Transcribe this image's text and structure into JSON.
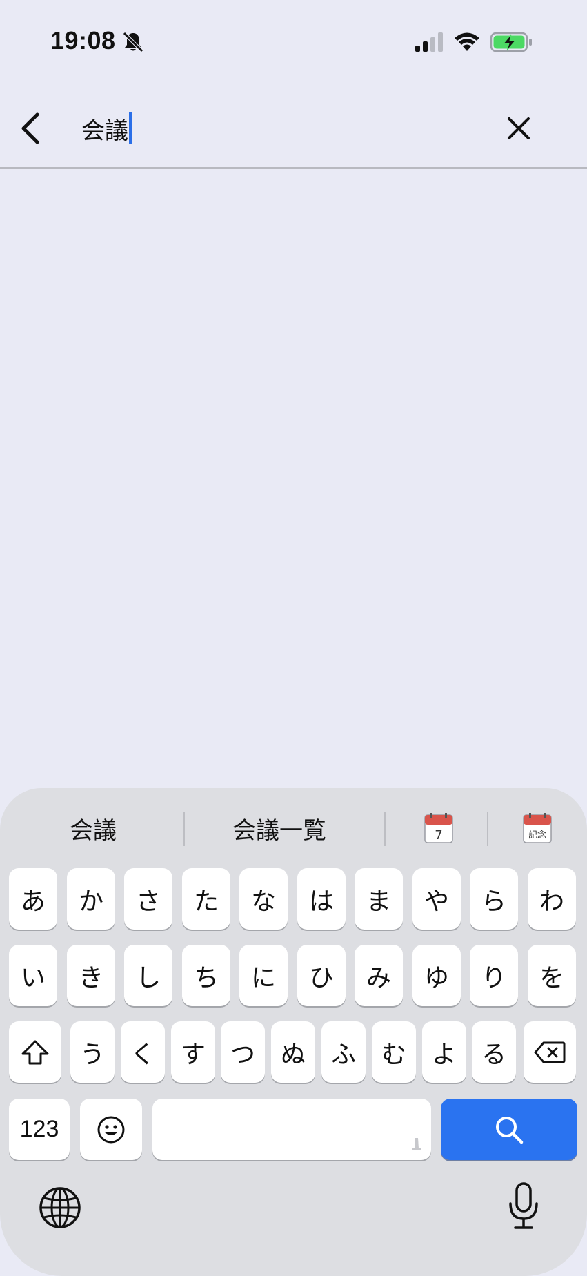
{
  "status_bar": {
    "time": "19:08",
    "icons": [
      "bell-off-icon",
      "cellular-signal-icon",
      "wifi-icon",
      "battery-charging-icon"
    ],
    "battery_color": "#4CD964"
  },
  "search": {
    "query": "会議",
    "caret_color": "#2B6FE8"
  },
  "keyboard": {
    "suggestions": [
      {
        "label": "会議"
      },
      {
        "label": "会議一覧"
      },
      {
        "icon": "calendar-date-icon",
        "text": "7"
      },
      {
        "icon": "calendar-anniversary-icon",
        "text": "記念"
      }
    ],
    "row1": [
      "あ",
      "か",
      "さ",
      "た",
      "な",
      "は",
      "ま",
      "や",
      "ら",
      "わ"
    ],
    "row2": [
      "い",
      "き",
      "し",
      "ち",
      "に",
      "ひ",
      "み",
      "ゆ",
      "り",
      "を"
    ],
    "row3": [
      "う",
      "く",
      "す",
      "つ",
      "ぬ",
      "ふ",
      "む",
      "よ",
      "る"
    ],
    "numbers_label": "123",
    "search_key_color": "#2A73F0"
  }
}
